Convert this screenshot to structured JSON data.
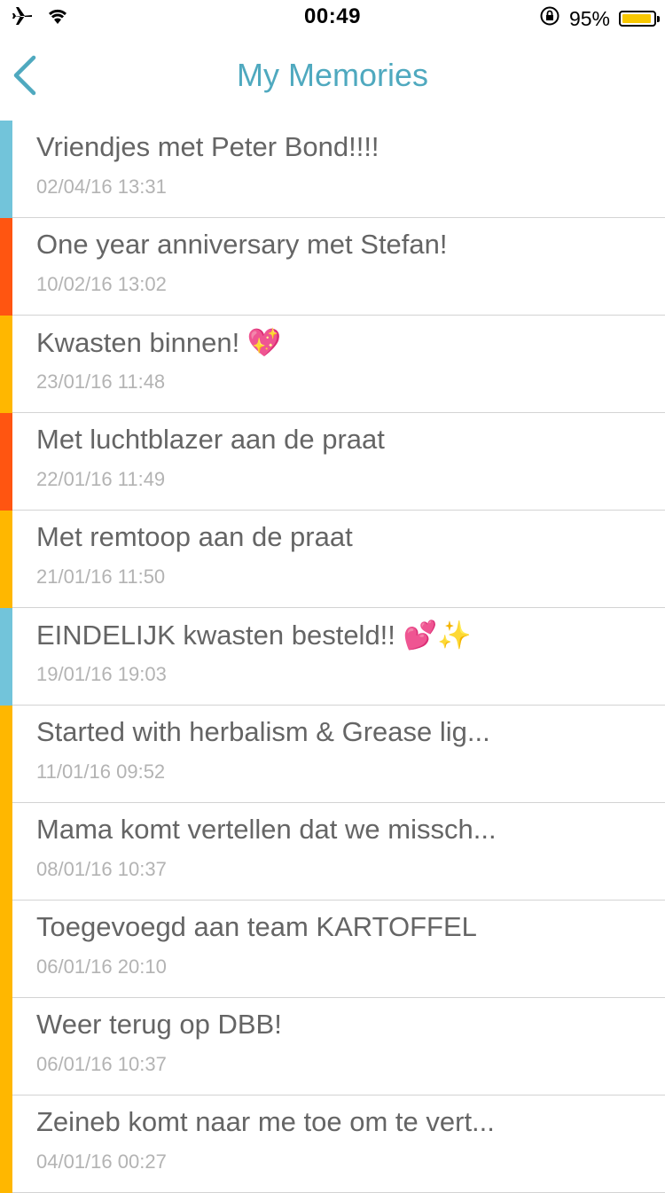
{
  "status_bar": {
    "time": "00:49",
    "battery_percent_label": "95%",
    "battery_level": 0.95,
    "battery_color": "#f7c700",
    "icons": [
      "airplane-icon",
      "wifi-icon",
      "rotation-lock-icon",
      "battery-icon"
    ]
  },
  "nav": {
    "title": "My Memories",
    "back_icon": "chevron-left-icon",
    "accent_color": "#4fa9bf"
  },
  "colors": {
    "blue": "#72c4da",
    "red": "#ff5511",
    "yellow": "#ffb700"
  },
  "memories": [
    {
      "title": "Vriendjes met Peter Bond!!!!",
      "date": "02/04/16 13:31",
      "color": "#72c4da"
    },
    {
      "title": "One year anniversary met Stefan!",
      "date": "10/02/16 13:02",
      "color": "#ff5511"
    },
    {
      "title": "Kwasten binnen! 💖",
      "date": "23/01/16 11:48",
      "color": "#ffb700"
    },
    {
      "title": "Met luchtblazer aan de praat",
      "date": "22/01/16 11:49",
      "color": "#ff5511"
    },
    {
      "title": "Met remtoop aan de praat",
      "date": "21/01/16 11:50",
      "color": "#ffb700"
    },
    {
      "title": "EINDELIJK kwasten besteld!! 💕✨",
      "date": "19/01/16 19:03",
      "color": "#72c4da"
    },
    {
      "title": "Started with herbalism & Grease lig...",
      "date": "11/01/16 09:52",
      "color": "#ffb700"
    },
    {
      "title": "Mama komt vertellen dat we missch...",
      "date": "08/01/16 10:37",
      "color": "#ffb700"
    },
    {
      "title": "Toegevoegd aan team KARTOFFEL",
      "date": "06/01/16 20:10",
      "color": "#ffb700"
    },
    {
      "title": "Weer terug op DBB!",
      "date": "06/01/16 10:37",
      "color": "#ffb700"
    },
    {
      "title": "Zeineb komt naar me toe om te vert...",
      "date": "04/01/16 00:27",
      "color": "#ffb700"
    }
  ]
}
